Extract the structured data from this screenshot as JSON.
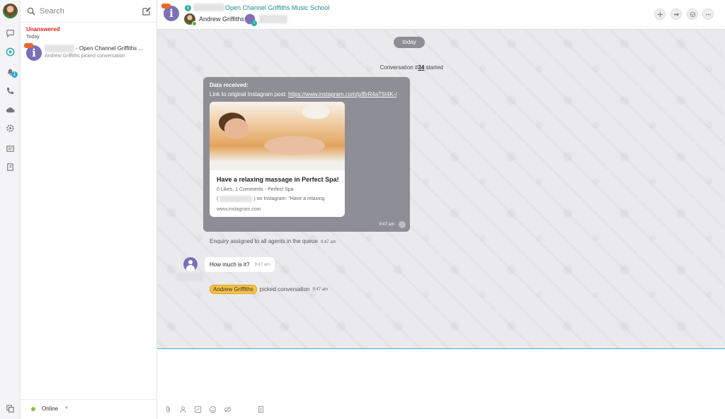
{
  "colors": {
    "accent": "#2ab0a4",
    "unanswered": "#e02020",
    "bubble_system": "#8e8e96",
    "online": "#7ac943",
    "agent_badge": "#f5c244",
    "channel_icon": "#7b6fb8"
  },
  "rail": {
    "items": [
      "chat-bubble-icon",
      "conversations-icon",
      "notifications-icon",
      "phone-icon",
      "cloud-icon",
      "settings-icon",
      "reports-icon",
      "contacts-book-icon"
    ],
    "notification_count": "1",
    "bottom_icon": "copy-windows-icon"
  },
  "list": {
    "search_placeholder": "Search",
    "section_title": "Unanswered",
    "section_date": "Today",
    "conversations": [
      {
        "title": "- Open Channel Griffiths ...",
        "subtitle": "Andrew Griffiths picked conversation"
      }
    ],
    "status": "Online"
  },
  "header": {
    "channel_name": "Open Channel Griffiths Music School",
    "agent_name": "Andrew Griffiths",
    "actions": [
      "add-icon",
      "forward-icon",
      "resolve-icon",
      "more-icon"
    ]
  },
  "chat": {
    "date_pill": "today",
    "conversation_started_prefix": "Conversation #",
    "conversation_number": "34",
    "conversation_started_suffix": " started",
    "message": {
      "heading": "Data received:",
      "link_prefix": "Link to original Instagram post: ",
      "link_url": "https://www.instagram.com/p/BrR4aT5I4K-/",
      "preview_title": "Have a relaxing massage in Perfect Spa!",
      "preview_meta": "0 Likes, 1 Comments - Perfect Spa",
      "preview_line_open": "(",
      "preview_line_rest": ") on Instagram: \"Have a relaxing",
      "preview_domain": "www.instagram.com",
      "time": "9:47 am"
    },
    "system_1": {
      "text": "Enquiry assigned to all agents in the queue",
      "time": "9:47 am"
    },
    "customer_message": {
      "text": "How much is it?",
      "time": "9:47 am"
    },
    "system_2": {
      "agent": "Andrew Griffiths",
      "text": "picked conversation",
      "time": "9:47 am"
    }
  },
  "composer": {
    "tools": [
      "attachment-icon",
      "contact-icon",
      "template-icon",
      "emoji-icon",
      "mute-icon",
      "note-icon"
    ]
  }
}
